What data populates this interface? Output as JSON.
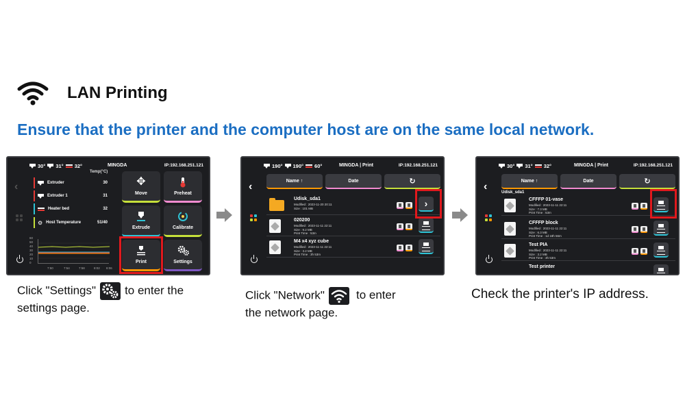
{
  "header": {
    "title": "LAN Printing",
    "icon": "wifi-icon"
  },
  "subtitle": "Ensure that the printer and the computer host are on the same local network.",
  "colors": {
    "accent_blue": "#1b6ec2",
    "highlight_red": "#e0191d",
    "screen_bg": "#1c1d20"
  },
  "screen1": {
    "temps": [
      "30°",
      "31°",
      "32°"
    ],
    "brand": "MINGDA",
    "ip": "IP:192.168.251.121",
    "temp_header": "Temp(°C)",
    "rows": [
      {
        "label": "Extruder",
        "value": "30",
        "color": "#e53935"
      },
      {
        "label": "Extruder 1",
        "value": "31",
        "color": "#e53935"
      },
      {
        "label": "Heater bed",
        "value": "32",
        "color": "#2ec4d6"
      },
      {
        "label": "Host Temperature",
        "value": "51/40",
        "color": "#c6e03a"
      }
    ],
    "graph_y": [
      "60",
      "50",
      "40",
      "30",
      "20",
      "10",
      "0"
    ],
    "graph_x": [
      "7:50",
      "7:54",
      "7:58",
      "8:02",
      "8:06"
    ],
    "tiles": {
      "move": "Move",
      "preheat": "Preheat",
      "extrude": "Extrude",
      "calibrate": "Calibrate",
      "print": "Print",
      "settings": "Settings"
    }
  },
  "screen2": {
    "temps": [
      "190°",
      "190°",
      "60°"
    ],
    "brand": "MINGDA | Print",
    "ip": "IP:192.168.251.121",
    "sort": {
      "name": "Name ↑",
      "date": "Date",
      "refresh": "↻"
    },
    "files": [
      {
        "name": "Udisk_sda1",
        "modified": "Modified : 2023-11-20 20:11",
        "size": "Size : 101 MB",
        "time": ""
      },
      {
        "name": "020200",
        "modified": "Modified : 2023-11-11 22:11",
        "size": "Size : 9.2 MB",
        "time": "Print Time : 53m"
      },
      {
        "name": "M4 x4 xyz cube",
        "modified": "Modified : 2023-11-11 22:11",
        "size": "Size : 3.2 MB",
        "time": "Print Time : 3h 53m"
      }
    ]
  },
  "screen3": {
    "temps": [
      "30°",
      "31°",
      "32°"
    ],
    "brand": "MINGDA | Print",
    "ip": "IP:192.168.251.121",
    "sort": {
      "name": "Name ↑",
      "date": "Date",
      "refresh": "↻"
    },
    "folder": "Udisk_sda1",
    "files": [
      {
        "name": "CFFFP 01-vase",
        "modified": "Modified : 2023-11-11 22:11",
        "size": "Size : 7.3 MB",
        "time": "Print Time : 53m"
      },
      {
        "name": "CFFFP block",
        "modified": "Modified : 2023-11-11 22:11",
        "size": "Size : 6.3 MB",
        "time": "Print Time : 1d 18h 56m"
      },
      {
        "name": "Test PIA",
        "modified": "Modified : 2023-11-11 22:11",
        "size": "Size : 3.2 MB",
        "time": "Print Time : 3h 53m"
      },
      {
        "name": "Test printer",
        "modified": "",
        "size": "",
        "time": ""
      }
    ]
  },
  "captions": {
    "c1_pre": "Click \"Settings\"",
    "c1_post": "to enter the",
    "c1_line2": "settings page.",
    "c2_pre": "Click \"Network\"",
    "c2_post": "to enter",
    "c2_line2": "the network page.",
    "c3": "Check the printer's IP address."
  }
}
